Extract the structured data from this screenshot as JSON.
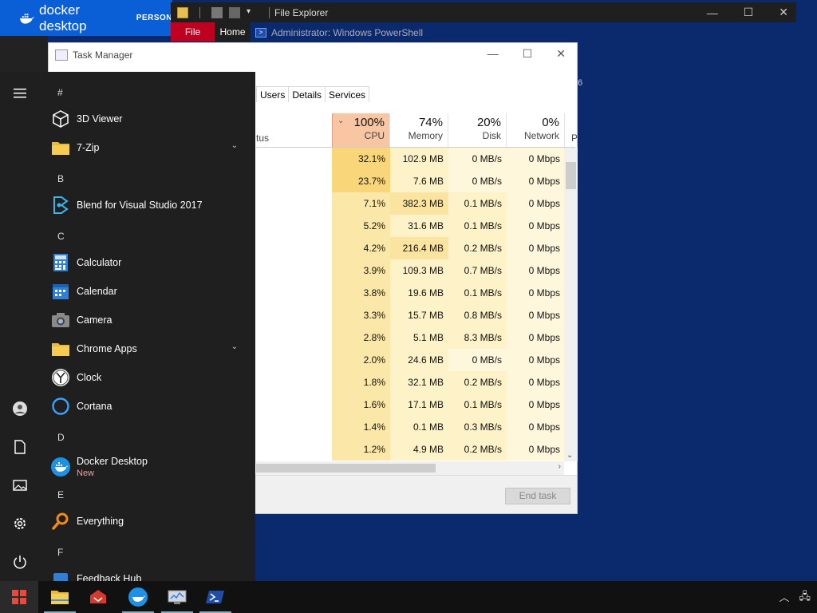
{
  "docker": {
    "brand": "docker desktop",
    "edition": "PERSON"
  },
  "file_explorer": {
    "title": "File Explorer",
    "tab_file": "File",
    "tab_home": "Home"
  },
  "powershell": {
    "title": "Administrator: Windows PowerShell",
    "side_text": "6"
  },
  "task_manager": {
    "title": "Task Manager",
    "tabs": [
      "Users",
      "Details",
      "Services"
    ],
    "status_header": "tus",
    "p_header": "P",
    "columns": [
      {
        "pct": "100%",
        "label": "CPU",
        "sorted": true
      },
      {
        "pct": "74%",
        "label": "Memory"
      },
      {
        "pct": "20%",
        "label": "Disk"
      },
      {
        "pct": "0%",
        "label": "Network"
      }
    ],
    "rows": [
      [
        "32.1%",
        "102.9 MB",
        "0 MB/s",
        "0 Mbps"
      ],
      [
        "23.7%",
        "7.6 MB",
        "0 MB/s",
        "0 Mbps"
      ],
      [
        "7.1%",
        "382.3 MB",
        "0.1 MB/s",
        "0 Mbps"
      ],
      [
        "5.2%",
        "31.6 MB",
        "0.1 MB/s",
        "0 Mbps"
      ],
      [
        "4.2%",
        "216.4 MB",
        "0.2 MB/s",
        "0 Mbps"
      ],
      [
        "3.9%",
        "109.3 MB",
        "0.7 MB/s",
        "0 Mbps"
      ],
      [
        "3.8%",
        "19.6 MB",
        "0.1 MB/s",
        "0 Mbps"
      ],
      [
        "3.3%",
        "15.7 MB",
        "0.8 MB/s",
        "0 Mbps"
      ],
      [
        "2.8%",
        "5.1 MB",
        "8.3 MB/s",
        "0 Mbps"
      ],
      [
        "2.0%",
        "24.6 MB",
        "0 MB/s",
        "0 Mbps"
      ],
      [
        "1.8%",
        "32.1 MB",
        "0.2 MB/s",
        "0 Mbps"
      ],
      [
        "1.6%",
        "17.1 MB",
        "0.1 MB/s",
        "0 Mbps"
      ],
      [
        "1.4%",
        "0.1 MB",
        "0.3 MB/s",
        "0 Mbps"
      ],
      [
        "1.2%",
        "4.9 MB",
        "0.2 MB/s",
        "0 Mbps"
      ]
    ],
    "end_task": "End task"
  },
  "start_menu": {
    "letters": [
      "#",
      "B",
      "C",
      "D",
      "E",
      "F"
    ],
    "apps": [
      {
        "label": "3D Viewer",
        "icon": "cube-icon"
      },
      {
        "label": "7-Zip",
        "icon": "folder-icon",
        "expand": true
      },
      {
        "label": "Blend for Visual Studio 2017",
        "icon": "blend-icon"
      },
      {
        "label": "Calculator",
        "icon": "calculator-icon"
      },
      {
        "label": "Calendar",
        "icon": "calendar-icon"
      },
      {
        "label": "Camera",
        "icon": "camera-icon"
      },
      {
        "label": "Chrome Apps",
        "icon": "folder-icon",
        "expand": true
      },
      {
        "label": "Clock",
        "icon": "clock-icon"
      },
      {
        "label": "Cortana",
        "icon": "cortana-icon"
      },
      {
        "label": "Docker Desktop",
        "icon": "docker-icon",
        "sub": "New"
      },
      {
        "label": "Everything",
        "icon": "search-icon"
      },
      {
        "label": "Feedback Hub",
        "icon": "feedback-icon"
      }
    ]
  }
}
